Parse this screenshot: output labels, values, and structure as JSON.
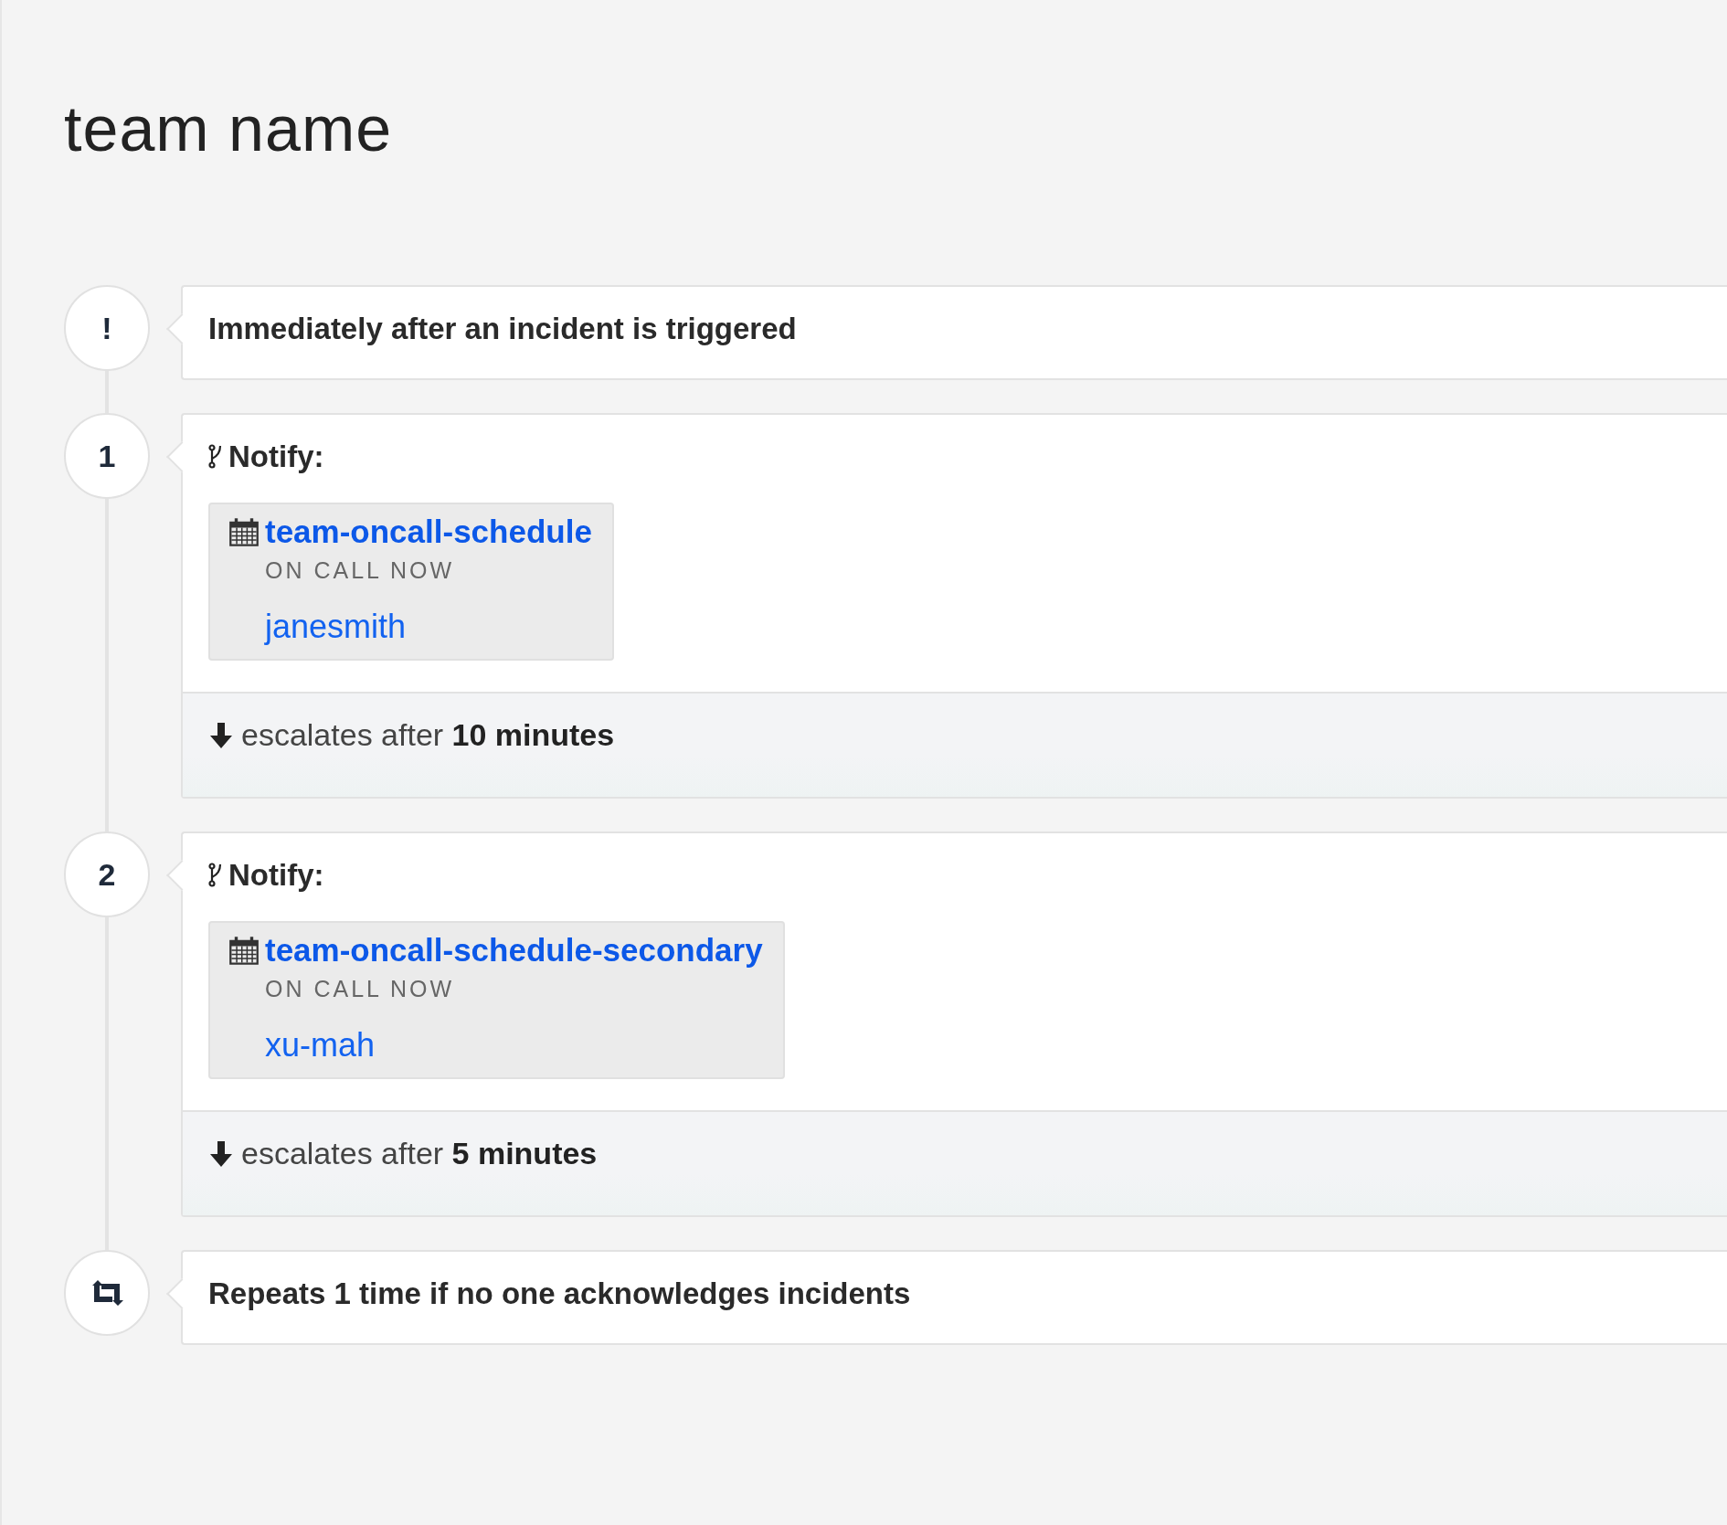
{
  "title": "team name",
  "steps": [
    {
      "kind": "trigger",
      "marker": "!",
      "text": "Immediately after an incident is triggered"
    },
    {
      "kind": "notify",
      "marker": "1",
      "label": "Notify:",
      "targets": [
        {
          "schedule": "team-oncall-schedule",
          "status": "ON CALL NOW",
          "users": [
            "janesmith"
          ]
        }
      ],
      "escalation": "escalates after **10 minutes**"
    },
    {
      "kind": "notify",
      "marker": "2",
      "label": "Notify:",
      "targets": [
        {
          "schedule": "team-oncall-schedule-secondary",
          "status": "ON CALL NOW",
          "users": [
            "xu-mah"
          ]
        }
      ],
      "escalation": "escalates after **5 minutes**"
    },
    {
      "kind": "repeat",
      "text": "Repeats 1 time if no one acknowledges incidents"
    }
  ]
}
